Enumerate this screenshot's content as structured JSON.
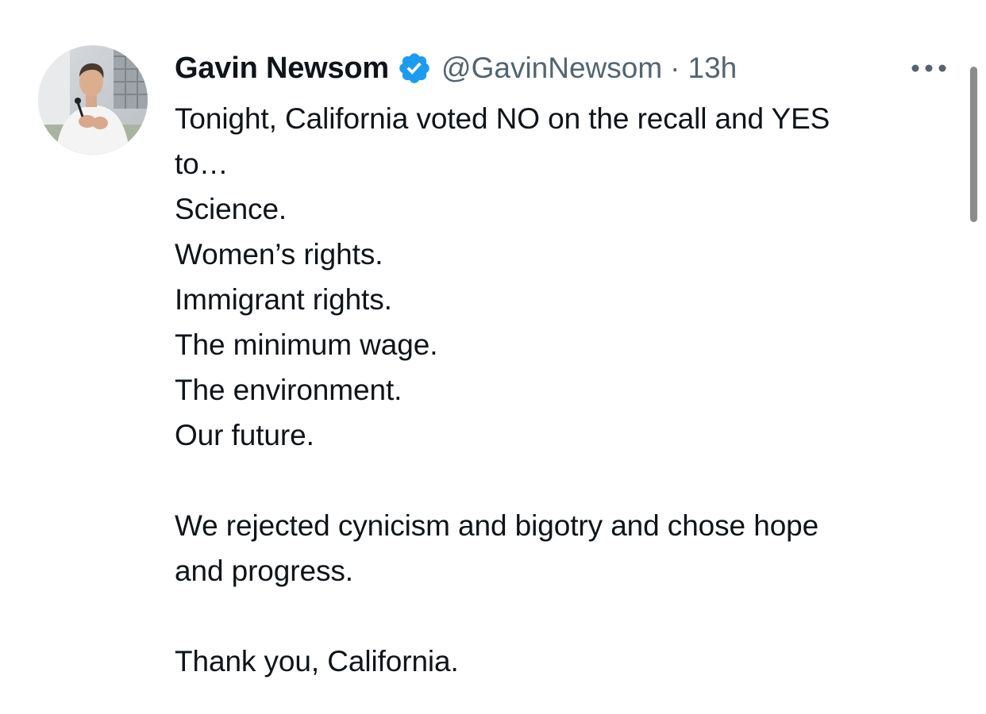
{
  "author": {
    "display_name": "Gavin Newsom",
    "handle": "@GavinNewsom",
    "separator": "·",
    "timestamp": "13h",
    "verified": true,
    "verified_icon": "verified-badge-icon",
    "avatar_icon": "profile-photo"
  },
  "tweet": {
    "lines": [
      "Tonight, California voted NO on the recall and YES",
      "to…",
      "Science.",
      "Women’s rights.",
      "Immigrant rights.",
      "The minimum wage.",
      "The environment.",
      "Our future.",
      "",
      "We rejected cynicism and bigotry and chose hope",
      "and progress.",
      "",
      "Thank you, California."
    ]
  },
  "actions": {
    "more_icon": "more-options-icon"
  },
  "colors": {
    "text_primary": "#0f1419",
    "text_secondary": "#536471",
    "verified_blue": "#1d9bf0",
    "background": "#ffffff",
    "scrollbar": "#8b8b8b"
  }
}
